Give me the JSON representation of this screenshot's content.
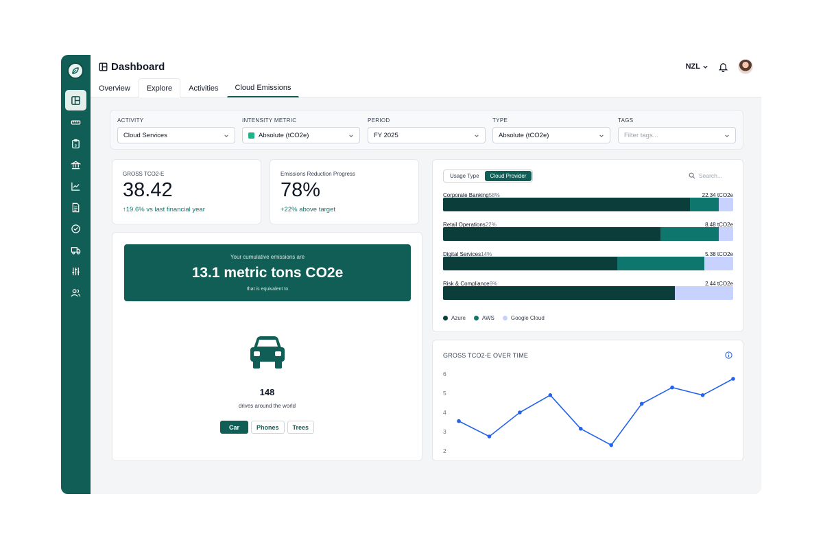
{
  "header": {
    "title": "Dashboard",
    "region": "NZL"
  },
  "tabs": [
    {
      "label": "Overview"
    },
    {
      "label": "Explore"
    },
    {
      "label": "Activities"
    },
    {
      "label": "Cloud Emissions"
    }
  ],
  "sidebar": {
    "items": [
      {
        "icon": "layout-icon",
        "active": true
      },
      {
        "icon": "ruler-icon"
      },
      {
        "icon": "clipboard-icon"
      },
      {
        "icon": "bank-icon"
      },
      {
        "icon": "chart-icon"
      },
      {
        "icon": "document-icon"
      },
      {
        "icon": "check-circle-icon"
      },
      {
        "icon": "truck-icon"
      },
      {
        "icon": "sliders-icon"
      },
      {
        "icon": "users-icon"
      }
    ]
  },
  "filters": {
    "activity": {
      "label": "ACTIVITY",
      "value": "Cloud Services"
    },
    "intensity": {
      "label": "INTENSITY METRIC",
      "value": "Absolute (tCO2e)"
    },
    "period": {
      "label": "PERIOD",
      "value": "FY 2025"
    },
    "type": {
      "label": "TYPE",
      "value": "Absolute (tCO2e)"
    },
    "tags": {
      "label": "TAGS",
      "placeholder": "Filter tags..."
    }
  },
  "kpis": {
    "gross": {
      "label": "GROSS TCO2-E",
      "value": "38.42",
      "delta": "↑19.6% vs last financial year"
    },
    "reduction": {
      "label": "Emissions Reduction Progress",
      "value": "78%",
      "delta": "+22% above target"
    }
  },
  "cumulative": {
    "intro": "Your cumulative emissions are",
    "value": "13.1 metric tons CO2e",
    "equiv_text": "that is equivalent to",
    "count": "148",
    "count_label": "drives around the world",
    "buttons": [
      {
        "label": "Car"
      },
      {
        "label": "Phones"
      },
      {
        "label": "Trees"
      }
    ]
  },
  "breakdown": {
    "toggle": {
      "left": "Usage Type",
      "right": "Cloud Provider"
    },
    "search_placeholder": "Search...",
    "rows": [
      {
        "name": "Corporate Banking",
        "pct": "58%",
        "value": "22.34 tCO2e",
        "shares": [
          0.85,
          0.1,
          0.05
        ]
      },
      {
        "name": "Retail Operations",
        "pct": "22%",
        "value": "8.48 tCO2e",
        "shares": [
          0.75,
          0.2,
          0.05
        ]
      },
      {
        "name": "Digital Services",
        "pct": "14%",
        "value": "5.38 tCO2e",
        "shares": [
          0.6,
          0.3,
          0.1
        ]
      },
      {
        "name": "Risk & Compliance",
        "pct": "6%",
        "value": "2.44 tCO2e",
        "shares": [
          0.8,
          0.0,
          0.2
        ]
      }
    ],
    "legend": [
      {
        "name": "Azure",
        "color": "#0b3d3a"
      },
      {
        "name": "AWS",
        "color": "#0f766e"
      },
      {
        "name": "Google Cloud",
        "color": "#c7d2fe"
      }
    ]
  },
  "chart_data": {
    "type": "line",
    "title": "GROSS TCO2-E OVER TIME",
    "yticks": [
      "6",
      "5",
      "4",
      "3",
      "2"
    ],
    "ylim": [
      2,
      6
    ],
    "x": [
      1,
      2,
      3,
      4,
      5,
      6,
      7,
      8,
      9,
      10
    ],
    "values": [
      3.55,
      2.75,
      4.0,
      4.9,
      3.15,
      2.3,
      4.45,
      5.3,
      4.9,
      5.75
    ],
    "color": "#2563eb",
    "grid": false,
    "legend": "none"
  }
}
